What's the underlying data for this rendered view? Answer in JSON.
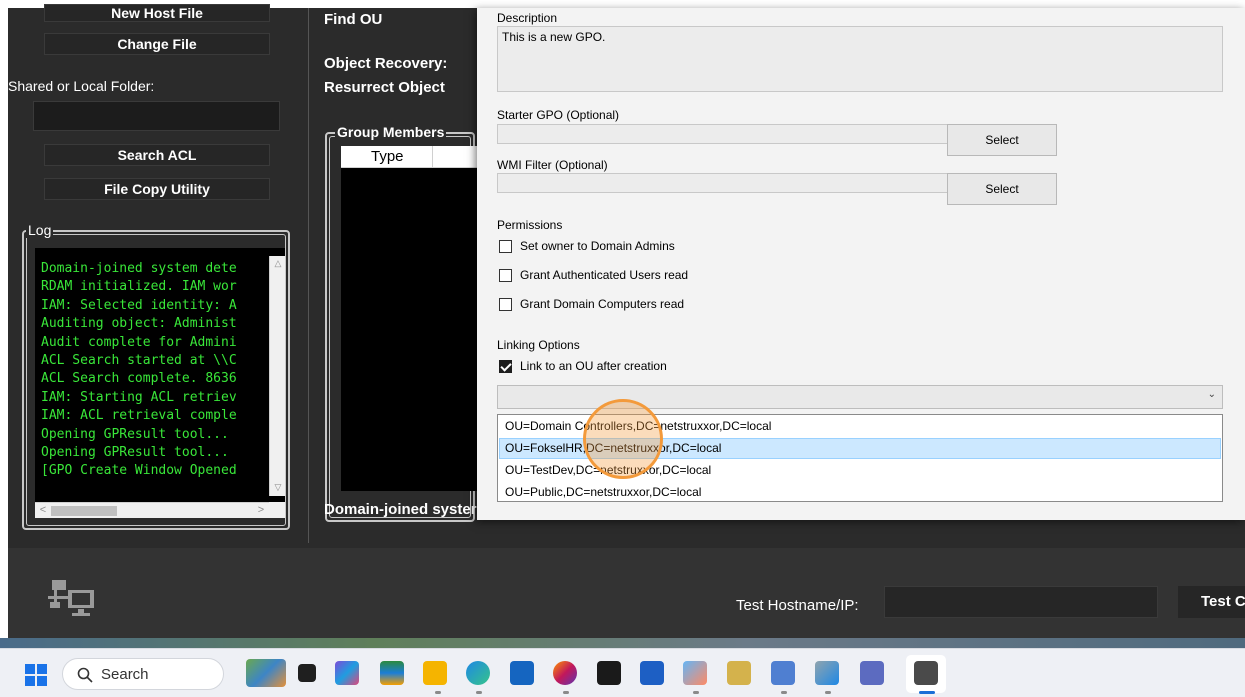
{
  "left_panel": {
    "new_host_file": "New Host File",
    "change_file": "Change File",
    "shared_folder_label": "Shared or Local Folder:",
    "search_acl": "Search ACL",
    "file_copy_utility": "File Copy Utility",
    "log_title": "Log",
    "log_lines": [
      "Domain-joined system dete",
      "RDAM initialized. IAM wor",
      "IAM: Selected identity: A",
      "Auditing object: Administ",
      "Audit complete for Admini",
      "ACL Search started at \\\\C",
      "ACL Search complete. 8636",
      "IAM: Starting ACL retriev",
      "IAM: ACL retrieval comple",
      "Opening GPResult tool...",
      "Opening GPResult tool...",
      "[GPO Create Window Opened"
    ]
  },
  "mid_panel": {
    "find_ou": "Find OU",
    "object_recovery": "Object Recovery:",
    "resurrect_object": "Resurrect Object",
    "group_members_title": "Group Members",
    "type_column": "Type",
    "status_text": "Domain-joined syster"
  },
  "dialog": {
    "description_label": "Description",
    "description_value": "This is a new GPO.",
    "starter_gpo_label": "Starter GPO (Optional)",
    "wmi_filter_label": "WMI Filter (Optional)",
    "select_label": "Select",
    "permissions_label": "Permissions",
    "permissions": [
      {
        "label": "Set owner to Domain Admins",
        "checked": false
      },
      {
        "label": "Grant Authenticated Users read",
        "checked": false
      },
      {
        "label": "Grant Domain Computers read",
        "checked": false
      }
    ],
    "linking_label": "Linking Options",
    "link_option": {
      "label": "Link to an OU after creation",
      "checked": true
    },
    "ou_combo_value": "",
    "ou_options": [
      {
        "label": "OU=Domain Controllers,DC=netstruxxor,DC=local",
        "selected": false
      },
      {
        "label": "OU=FokselHR,DC=netstruxxor,DC=local",
        "selected": true
      },
      {
        "label": "OU=TestDev,DC=netstruxxor,DC=local",
        "selected": false
      },
      {
        "label": "OU=Public,DC=netstruxxor,DC=local",
        "selected": false
      }
    ]
  },
  "bottom_bar": {
    "test_hostname_label": "Test Hostname/IP:",
    "test_button_label": "Test C"
  },
  "taskbar": {
    "search_label": "Search"
  },
  "colors": {
    "app_background": "#2b2b2b",
    "log_text": "#39e639",
    "dropdown_selection": "#cce8ff",
    "click_highlight": "#f39a3b",
    "taskbar_accent": "#1a6fd6"
  }
}
